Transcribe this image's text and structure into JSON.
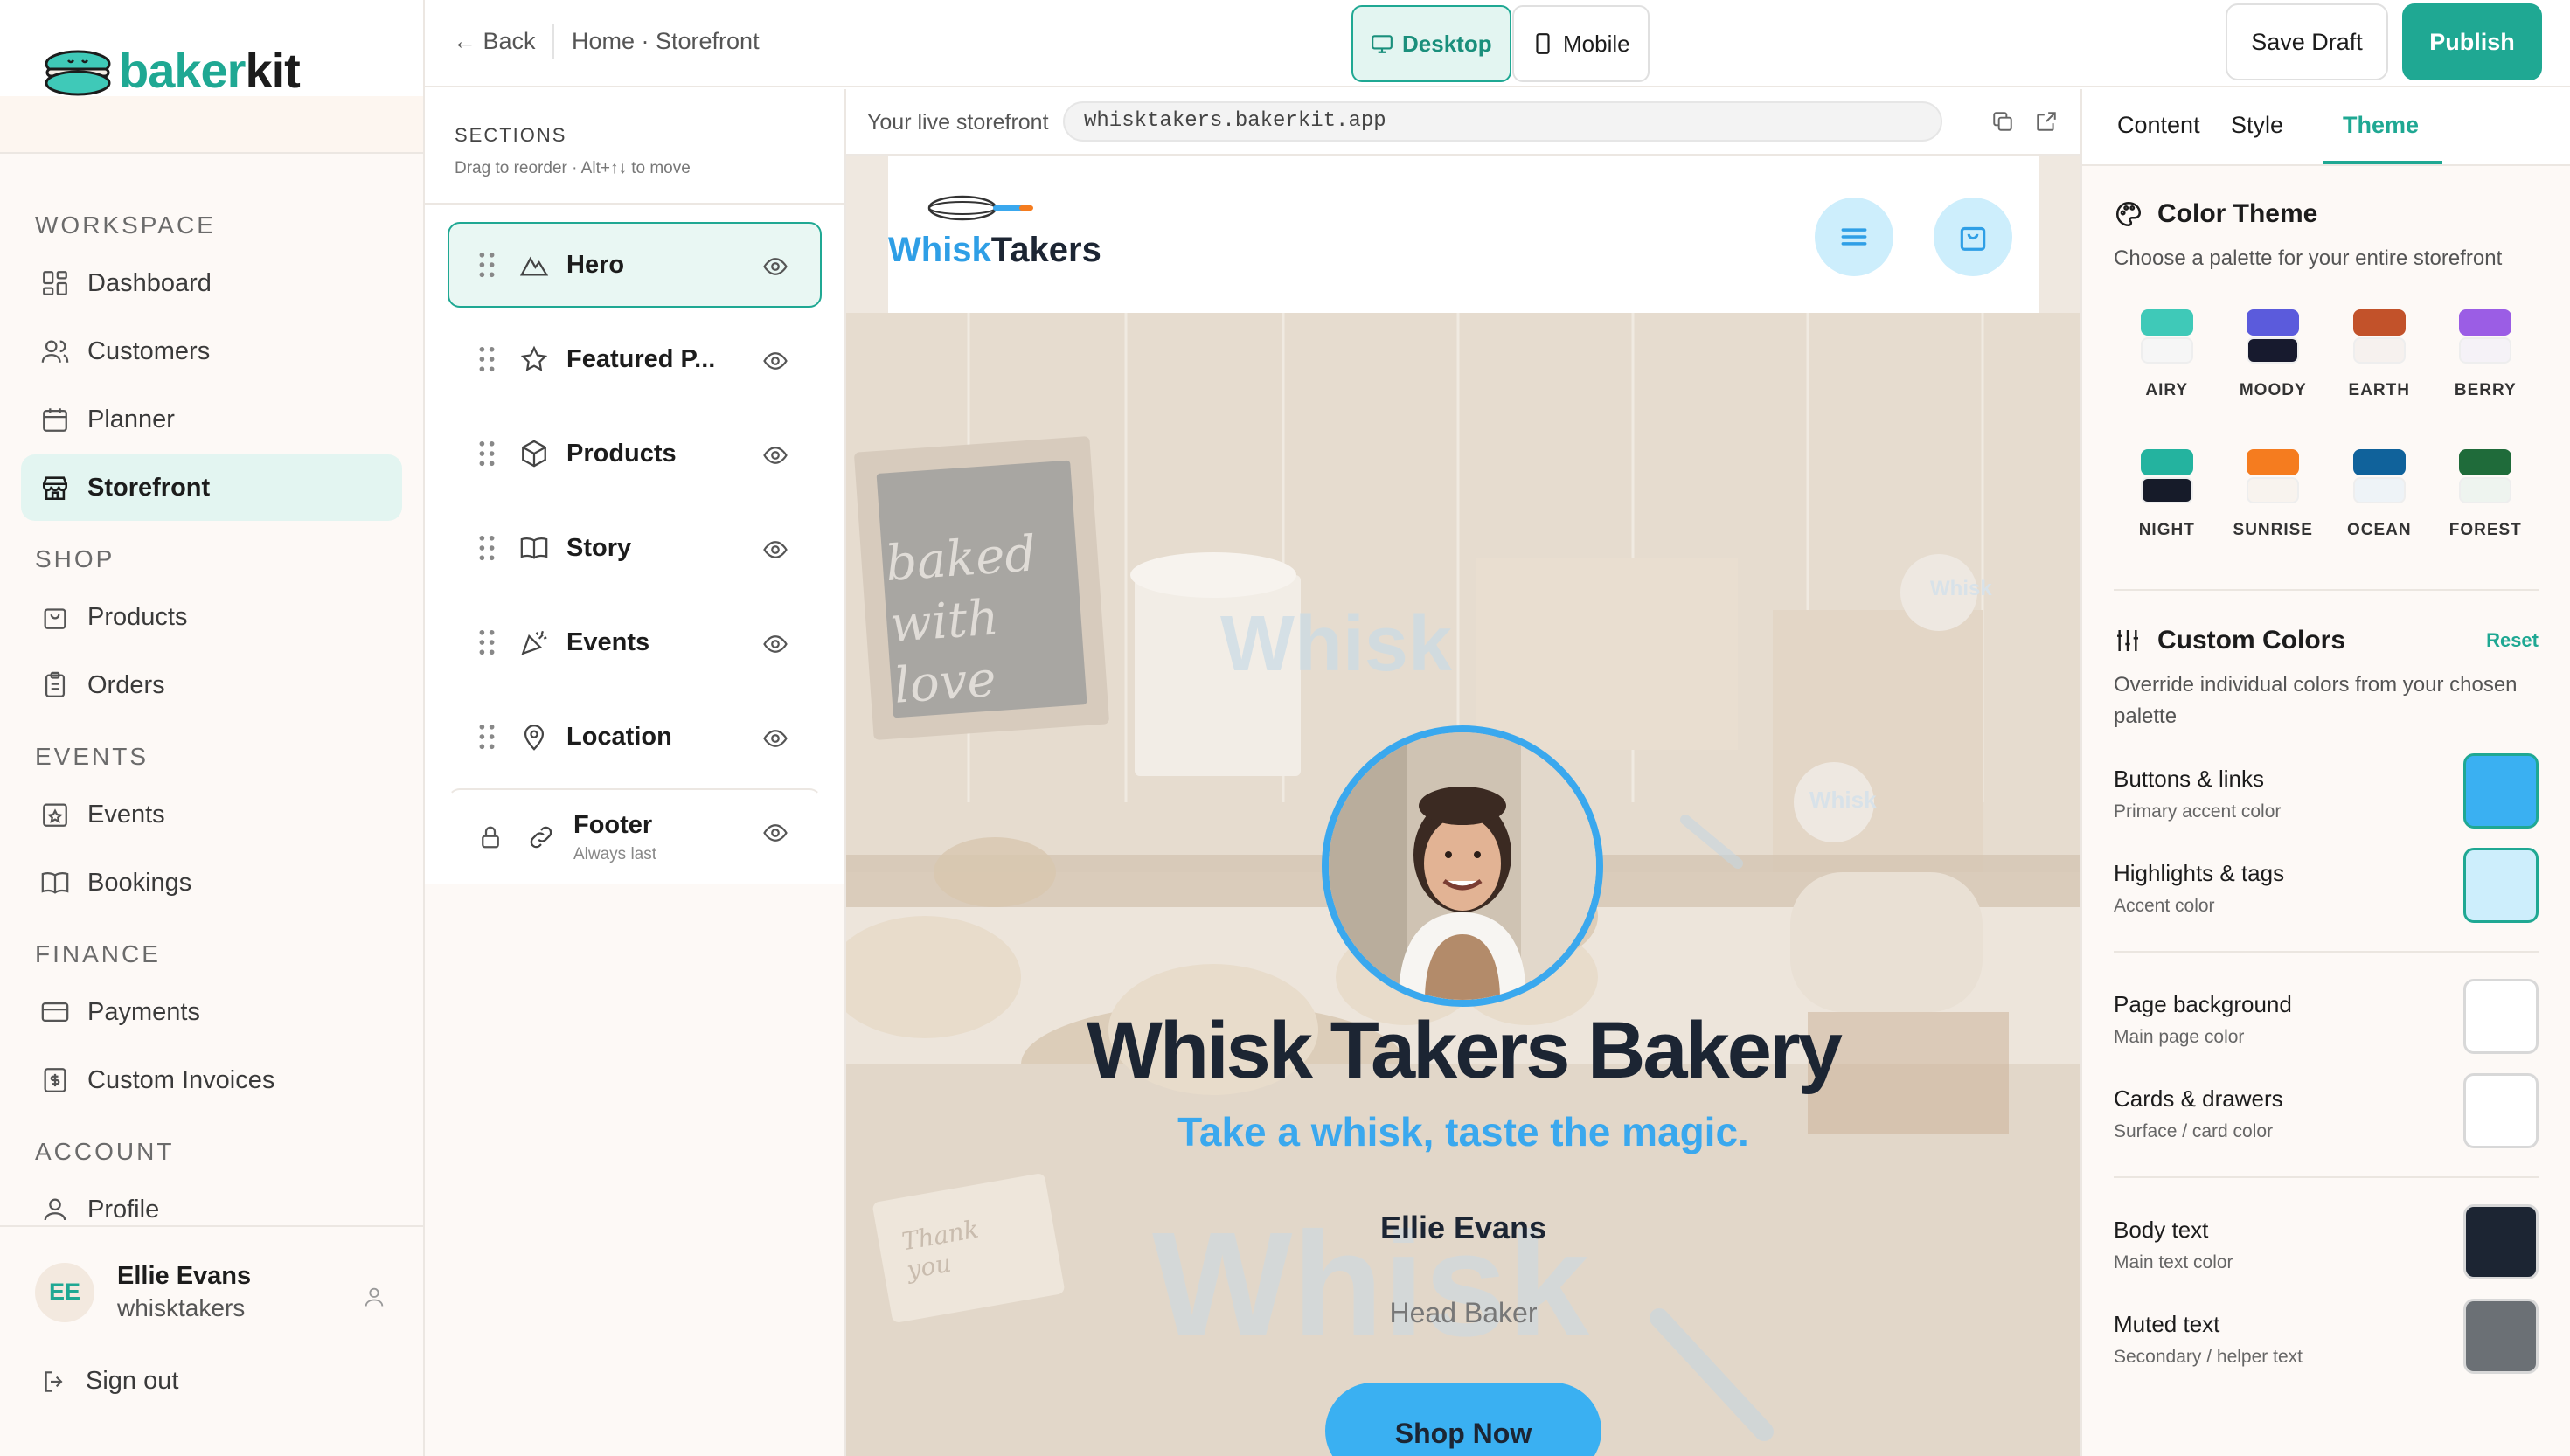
{
  "app": {
    "logo_part1": "baker",
    "logo_part2": "kit"
  },
  "sidebar": {
    "groups": [
      {
        "title": "WORKSPACE",
        "items": [
          {
            "label": "Dashboard",
            "icon": "dashboard-icon"
          },
          {
            "label": "Customers",
            "icon": "customers-icon"
          },
          {
            "label": "Planner",
            "icon": "calendar-icon"
          },
          {
            "label": "Storefront",
            "icon": "store-icon",
            "active": true
          }
        ]
      },
      {
        "title": "SHOP",
        "items": [
          {
            "label": "Products",
            "icon": "bag-icon"
          },
          {
            "label": "Orders",
            "icon": "clipboard-icon"
          }
        ]
      },
      {
        "title": "EVENTS",
        "items": [
          {
            "label": "Events",
            "icon": "event-icon"
          },
          {
            "label": "Bookings",
            "icon": "book-icon"
          }
        ]
      },
      {
        "title": "FINANCE",
        "items": [
          {
            "label": "Payments",
            "icon": "card-icon"
          },
          {
            "label": "Custom Invoices",
            "icon": "invoice-icon"
          }
        ]
      },
      {
        "title": "ACCOUNT",
        "items": [
          {
            "label": "Profile",
            "icon": "user-icon"
          }
        ]
      }
    ],
    "user": {
      "initials": "EE",
      "name": "Ellie Evans",
      "handle": "whisktakers"
    },
    "signout": "Sign out"
  },
  "topbar": {
    "back": "← Back",
    "breadcrumb": "Home · Storefront",
    "device_desktop": "Desktop",
    "device_mobile": "Mobile",
    "save_draft": "Save Draft",
    "publish": "Publish"
  },
  "sections_panel": {
    "title": "SECTIONS",
    "hint": "Drag to reorder · Alt+↑↓ to move",
    "items": [
      {
        "label": "Hero",
        "icon": "mountain-icon",
        "active": true
      },
      {
        "label": "Featured P...",
        "icon": "star-icon"
      },
      {
        "label": "Products",
        "icon": "box-icon"
      },
      {
        "label": "Story",
        "icon": "open-book-icon"
      },
      {
        "label": "Events",
        "icon": "party-icon"
      },
      {
        "label": "Location",
        "icon": "pin-icon"
      }
    ],
    "footer": {
      "label": "Footer",
      "sub": "Always last"
    }
  },
  "preview": {
    "url_label": "Your live storefront",
    "url": "whisktakers.bakerkit.app",
    "site_name_part1": "Whisk",
    "site_name_part2": "Takers",
    "hero_title": "Whisk Takers Bakery",
    "hero_tagline": "Take a whisk, taste the magic.",
    "hero_name": "Ellie Evans",
    "hero_role": "Head Baker",
    "cta": "Shop Now",
    "sign_text": "baked with love",
    "deco_card_text": "Thank you",
    "watermark_word": "Whisk"
  },
  "theme_panel": {
    "tabs": [
      "Content",
      "Style",
      "Theme"
    ],
    "active_tab": "Theme",
    "color_theme_title": "Color Theme",
    "color_theme_sub": "Choose a palette for your entire storefront",
    "palettes": [
      {
        "name": "AIRY",
        "top": "#3fc9b8",
        "bottom": "#f6f6f6"
      },
      {
        "name": "MOODY",
        "top": "#5b5bdc",
        "bottom": "#171a2e"
      },
      {
        "name": "EARTH",
        "top": "#c2522a",
        "bottom": "#f6f1ee"
      },
      {
        "name": "BERRY",
        "top": "#9b5de5",
        "bottom": "#f5f2f7"
      },
      {
        "name": "NIGHT",
        "top": "#24b39f",
        "bottom": "#161b29"
      },
      {
        "name": "SUNRISE",
        "top": "#f57c1f",
        "bottom": "#f8f3ee"
      },
      {
        "name": "OCEAN",
        "top": "#10629b",
        "bottom": "#eef3f7"
      },
      {
        "name": "FOREST",
        "top": "#1f6b3a",
        "bottom": "#eef4ef"
      }
    ],
    "custom_title": "Custom Colors",
    "reset": "Reset",
    "custom_sub": "Override individual colors from your chosen palette",
    "colors": [
      {
        "name": "Buttons & links",
        "hint": "Primary accent color",
        "value": "#3ab0f2",
        "selected": true
      },
      {
        "name": "Highlights & tags",
        "hint": "Accent color",
        "value": "#cdeefc",
        "selected": true
      },
      {
        "name": "Page background",
        "hint": "Main page color",
        "value": "#ffffff"
      },
      {
        "name": "Cards & drawers",
        "hint": "Surface / card color",
        "value": "#ffffff"
      },
      {
        "name": "Body text",
        "hint": "Main text color",
        "value": "#1c2533"
      },
      {
        "name": "Muted text",
        "hint": "Secondary / helper text",
        "value": "#6b7075"
      }
    ]
  }
}
